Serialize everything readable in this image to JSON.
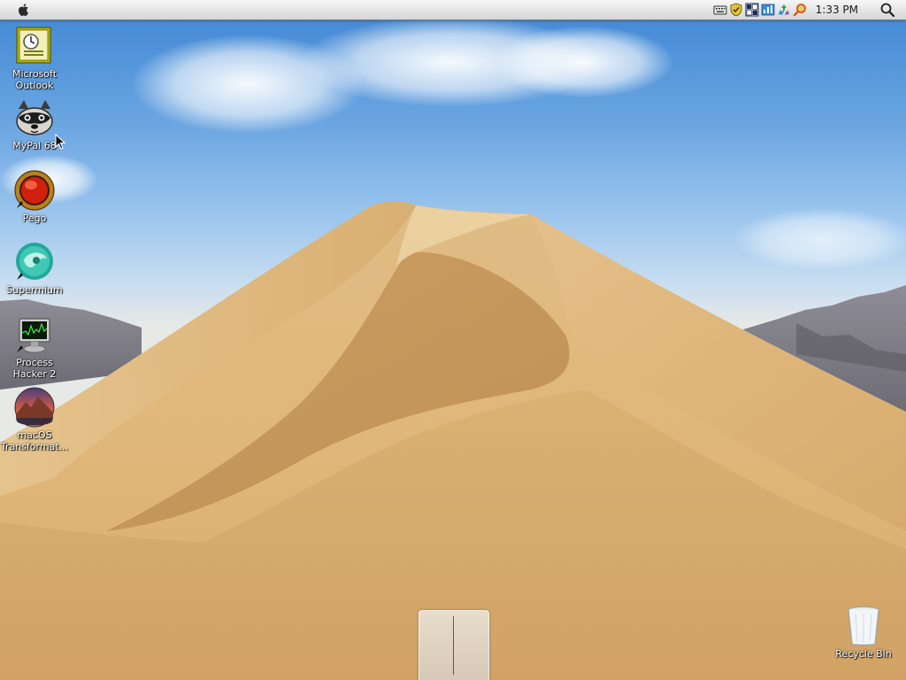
{
  "menubar": {
    "clock": "1:33 PM",
    "tray_icons": [
      "keyboard-icon",
      "shield-icon",
      "grid-icon",
      "network-icon",
      "recycle-icon",
      "search-magnifier-icon"
    ]
  },
  "desktop_icons": [
    {
      "name": "microsoft-outlook",
      "label": "Microsoft Outlook",
      "icon": "outlook-icon"
    },
    {
      "name": "mypal-68",
      "label": "MyPal 68",
      "icon": "raccoon-icon"
    },
    {
      "name": "pego",
      "label": "Pego",
      "icon": "red-orb-icon"
    },
    {
      "name": "supermium",
      "label": "Supermium",
      "icon": "supermium-icon"
    },
    {
      "name": "process-hacker-2",
      "label": "Process Hacker 2",
      "icon": "monitor-icon"
    },
    {
      "name": "macos-transformation",
      "label": "macOS Transformat...",
      "icon": "macos-sierra-icon"
    }
  ],
  "recycle_bin": {
    "label": "Recycle Bin",
    "icon": "trash-icon"
  },
  "colors": {
    "sky": "#4a8fd8",
    "sand": "#d9b47a",
    "menubar": "#e4e4e4"
  }
}
